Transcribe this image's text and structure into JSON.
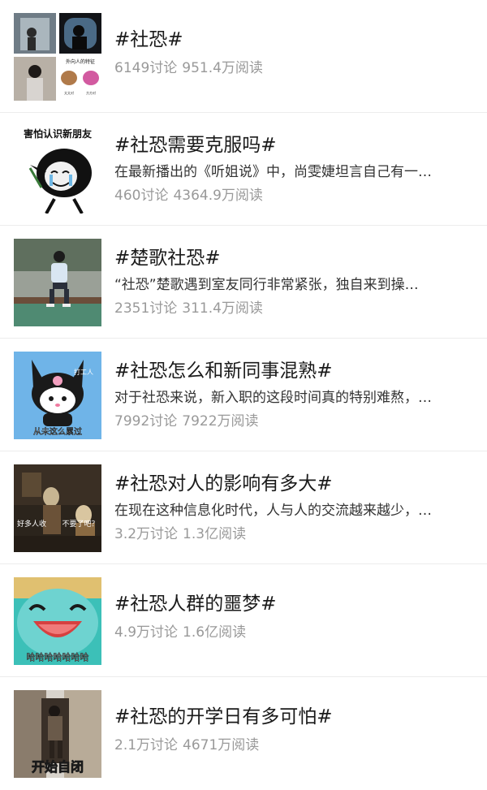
{
  "topics": [
    {
      "title": "#社恐#",
      "summary": "",
      "discussions": "6149讨论",
      "reads": "951.4万阅读",
      "thumb_icon": "photo-collage-icon",
      "thumb_text": [
        "外向人的特征",
        "太太对",
        "方方对"
      ]
    },
    {
      "title": "#社恐需要克服吗#",
      "summary": "在最新播出的《听姐说》中，尚雯婕坦言自己有一…",
      "discussions": "460讨论",
      "reads": "4364.9万阅读",
      "thumb_icon": "crying-meme-icon",
      "thumb_text": [
        "害怕认识新朋友"
      ]
    },
    {
      "title": "#楚歌社恐#",
      "summary": "“社恐”楚歌遇到室友同行非常紧张，独自来到操…",
      "discussions": "2351讨论",
      "reads": "311.4万阅读",
      "thumb_icon": "sitting-boy-photo-icon",
      "thumb_text": []
    },
    {
      "title": "#社恐怎么和新同事混熟#",
      "summary": "对于社恐来说，新入职的这段时间真的特别难熬，…",
      "discussions": "7992讨论",
      "reads": "7922万阅读",
      "thumb_icon": "kuromi-cartoon-icon",
      "thumb_text": [
        "打工人",
        "从未这么累过"
      ]
    },
    {
      "title": "#社恐对人的影响有多大#",
      "summary": "在现在这种信息化时代，人与人的交流越来越少，…",
      "discussions": "3.2万讨论",
      "reads": "1.3亿阅读",
      "thumb_icon": "painting-meme-icon",
      "thumb_text": [
        "好多人收",
        "不要了吧？"
      ]
    },
    {
      "title": "#社恐人群的噩梦#",
      "summary": "",
      "discussions": "4.9万讨论",
      "reads": "1.6亿阅读",
      "thumb_icon": "laughing-turtle-icon",
      "thumb_text": [
        "哈哈哈哈哈哈哈"
      ]
    },
    {
      "title": "#社恐的开学日有多可怕#",
      "summary": "",
      "discussions": "2.1万讨论",
      "reads": "4671万阅读",
      "thumb_icon": "door-hiding-icon",
      "thumb_text": [
        "开始自闭"
      ]
    }
  ]
}
